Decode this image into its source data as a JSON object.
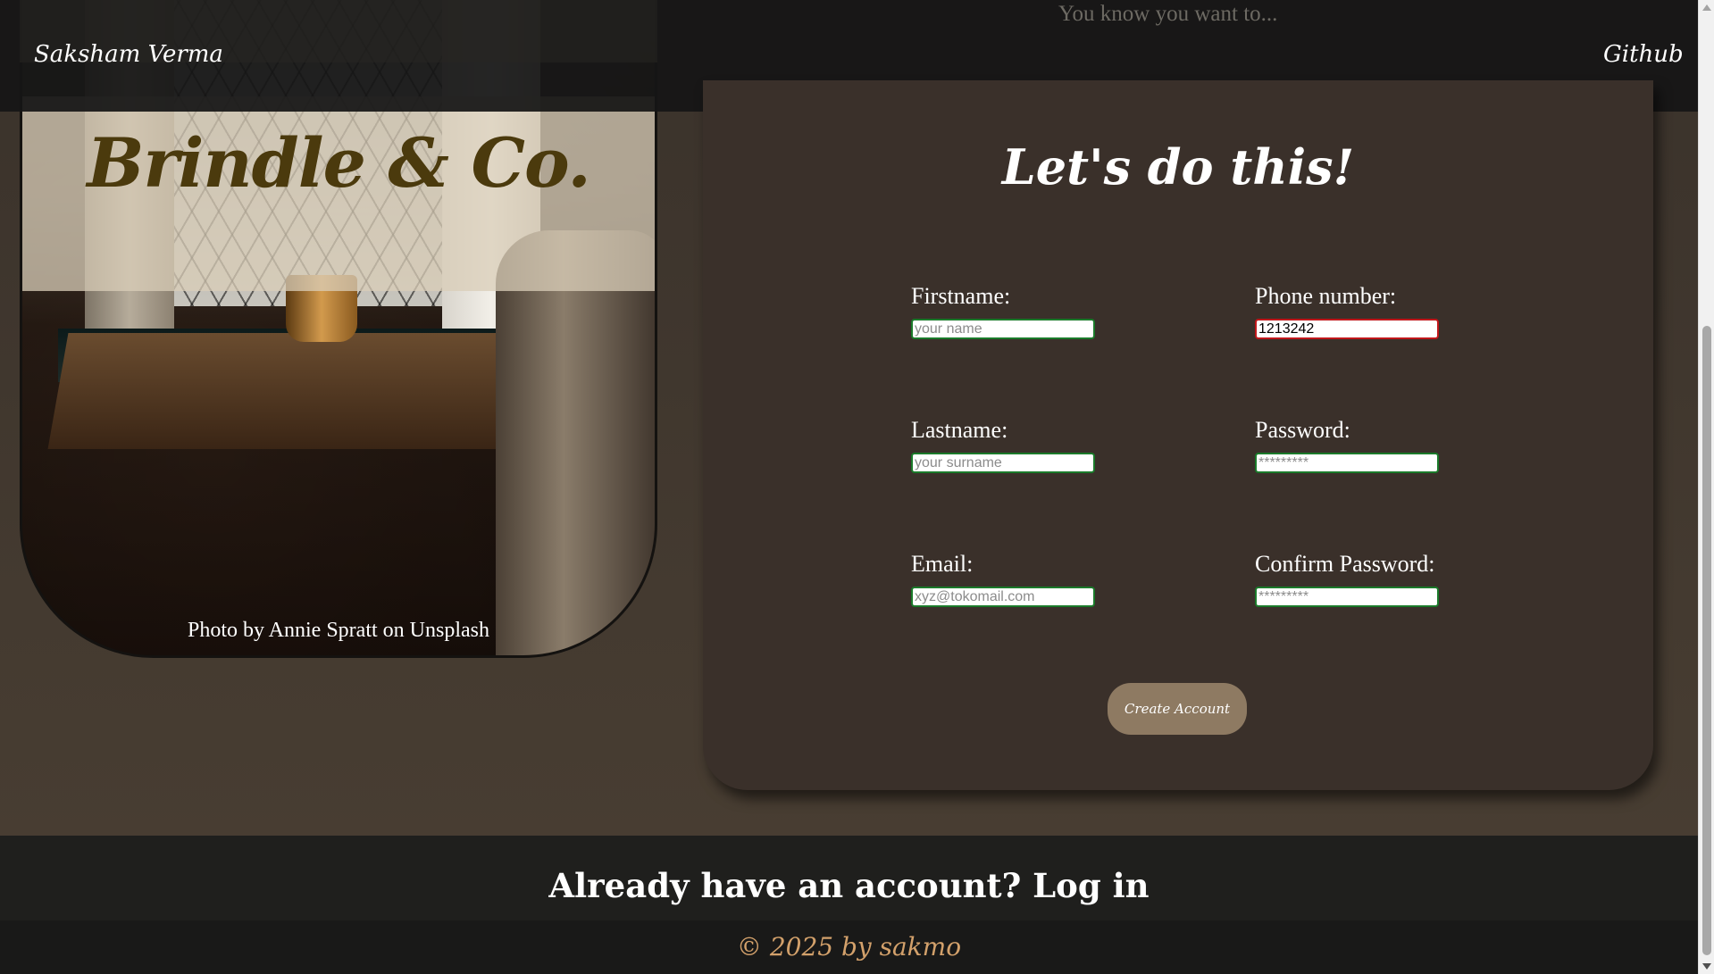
{
  "header": {
    "brand": "Saksham Verma",
    "tagline": "You know you want to...",
    "github_label": "Github"
  },
  "hero": {
    "brand_title": "Brindle & Co.",
    "photo_credit": "Photo by Annie Spratt on Unsplash"
  },
  "form": {
    "heading": "Let's do this!",
    "fields": {
      "firstname": {
        "label": "Firstname:",
        "placeholder": "your name",
        "value": ""
      },
      "phone": {
        "label": "Phone number:",
        "placeholder": "",
        "value": "1213242"
      },
      "lastname": {
        "label": "Lastname:",
        "placeholder": "your surname",
        "value": ""
      },
      "password": {
        "label": "Password:",
        "placeholder": "*********",
        "value": ""
      },
      "email": {
        "label": "Email:",
        "placeholder": "xyz@tokomail.com",
        "value": ""
      },
      "confirm_password": {
        "label": "Confirm Password:",
        "placeholder": "*********",
        "value": ""
      }
    },
    "submit_label": "Create Account"
  },
  "footer": {
    "login_prompt": "Already have an account? Log in",
    "copyright": "© 2025 by sakmo"
  },
  "colors": {
    "valid_border": "#1a7a2a",
    "invalid_border": "#c0171b",
    "button_bg": "#8e7a62",
    "copyright_text": "#d3a16b"
  }
}
